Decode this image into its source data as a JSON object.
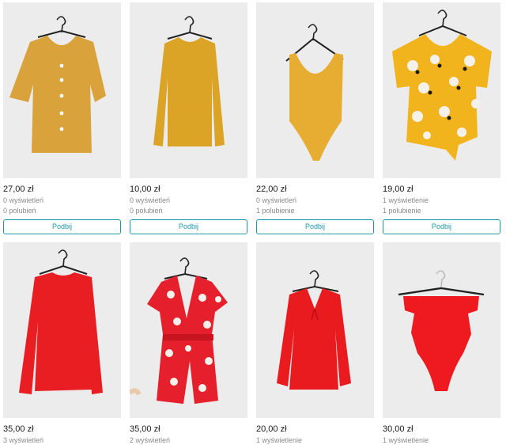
{
  "colors": {
    "accent": "#1b9aa6"
  },
  "items": [
    {
      "price": "27,00 zł",
      "views": "0 wyświetleń",
      "likes": "0 polubień",
      "button": "Podbij",
      "garment": "mustard-button-blouse",
      "color": "#d9a23b"
    },
    {
      "price": "10,00 zł",
      "views": "0 wyświetleń",
      "likes": "0 polubień",
      "button": "Podbij",
      "garment": "mustard-long-sleeve-top",
      "color": "#dba426"
    },
    {
      "price": "22,00 zł",
      "views": "0 wyświetleń",
      "likes": "1 polubienie",
      "button": "Podbij",
      "garment": "mustard-bodysuit",
      "color": "#e6ad32"
    },
    {
      "price": "19,00 zł",
      "views": "1 wyświetlenie",
      "likes": "1 polubienie",
      "button": "Podbij",
      "garment": "yellow-floral-tie-top",
      "color": "#f2b41c"
    },
    {
      "price": "35,00 zł",
      "views": "3 wyświetleń",
      "garment": "red-long-sleeve-top",
      "color": "#e81e22"
    },
    {
      "price": "35,00 zł",
      "views": "2 wyświetleń",
      "garment": "red-floral-playsuit",
      "color": "#e5202c"
    },
    {
      "price": "20,00 zł",
      "views": "1 wyświetlenie",
      "garment": "red-blouse",
      "color": "#ea1b1f"
    },
    {
      "price": "30,00 zł",
      "views": "1 wyświetlenie",
      "garment": "red-cutout-bodysuit",
      "color": "#ef1a1f"
    }
  ]
}
